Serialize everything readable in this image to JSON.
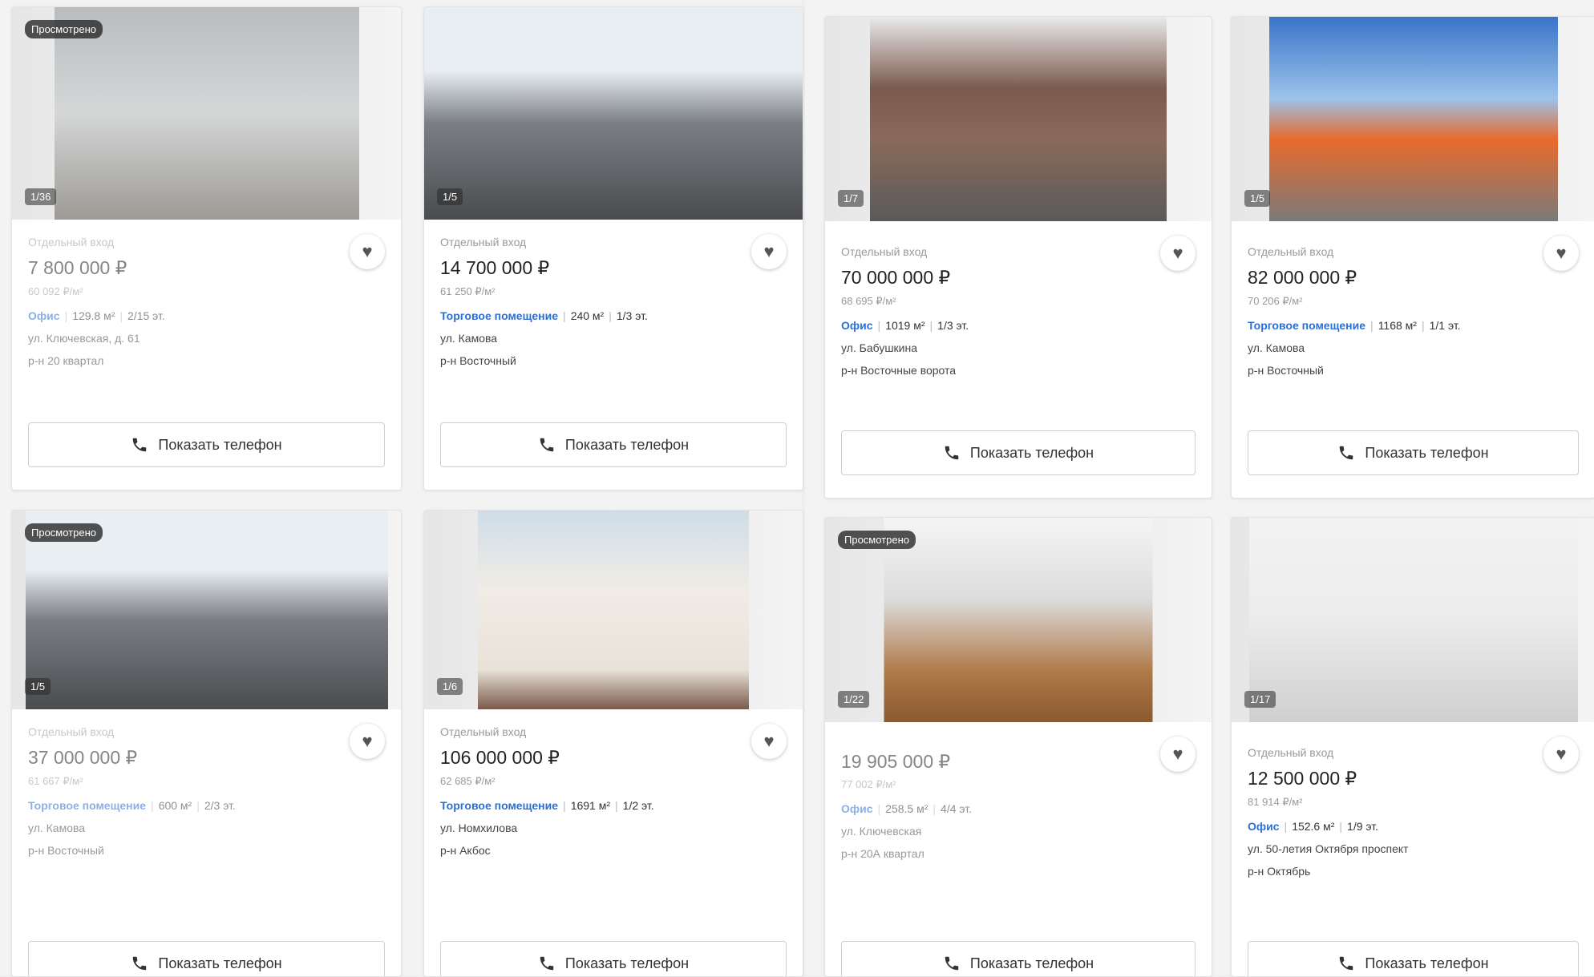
{
  "phone_label": "Показать телефон",
  "viewed_label": "Просмотрено",
  "cards": [
    {
      "entrance": "Отдельный вход",
      "price": "7 800 000 ₽",
      "ppm": "60 092 ₽/м²",
      "type": "Офис",
      "area": "129.8 м²",
      "floor": "2/15 эт.",
      "street": "ул. Ключевская, д. 61",
      "district": "р-н 20 квартал",
      "counter": "1/36",
      "viewed": true
    },
    {
      "entrance": "Отдельный вход",
      "price": "14 700 000 ₽",
      "ppm": "61 250 ₽/м²",
      "type": "Торговое помещение",
      "area": "240 м²",
      "floor": "1/3 эт.",
      "street": "ул. Камова",
      "district": "р-н Восточный",
      "counter": "1/5",
      "viewed": false
    },
    {
      "entrance": "Отдельный вход",
      "price": "70 000 000 ₽",
      "ppm": "68 695 ₽/м²",
      "type": "Офис",
      "area": "1019 м²",
      "floor": "1/3 эт.",
      "street": "ул. Бабушкина",
      "district": "р-н Восточные ворота",
      "counter": "1/7",
      "viewed": false
    },
    {
      "entrance": "Отдельный вход",
      "price": "82 000 000 ₽",
      "ppm": "70 206 ₽/м²",
      "type": "Торговое помещение",
      "area": "1168 м²",
      "floor": "1/1 эт.",
      "street": "ул. Камова",
      "district": "р-н Восточный",
      "counter": "1/5",
      "viewed": false
    },
    {
      "entrance": "Отдельный вход",
      "price": "37 000 000 ₽",
      "ppm": "61 667 ₽/м²",
      "type": "Торговое помещение",
      "area": "600 м²",
      "floor": "2/3 эт.",
      "street": "ул. Камова",
      "district": "р-н Восточный",
      "counter": "1/5",
      "viewed": true
    },
    {
      "entrance": "Отдельный вход",
      "price": "106 000 000 ₽",
      "ppm": "62 685 ₽/м²",
      "type": "Торговое помещение",
      "area": "1691 м²",
      "floor": "1/2 эт.",
      "street": "ул. Номхилова",
      "district": "р-н Акбос",
      "counter": "1/6",
      "viewed": false
    },
    {
      "entrance": "",
      "price": "19 905 000 ₽",
      "ppm": "77 002 ₽/м²",
      "type": "Офис",
      "area": "258.5 м²",
      "floor": "4/4 эт.",
      "street": "ул. Ключевская",
      "district": "р-н 20А квартал",
      "counter": "1/22",
      "viewed": true
    },
    {
      "entrance": "Отдельный вход",
      "price": "12 500 000 ₽",
      "ppm": "81 914 ₽/м²",
      "type": "Офис",
      "area": "152.6 м²",
      "floor": "1/9 эт.",
      "street": "ул. 50-летия Октября проспект",
      "district": "р-н Октябрь",
      "counter": "1/17",
      "viewed": false
    }
  ]
}
